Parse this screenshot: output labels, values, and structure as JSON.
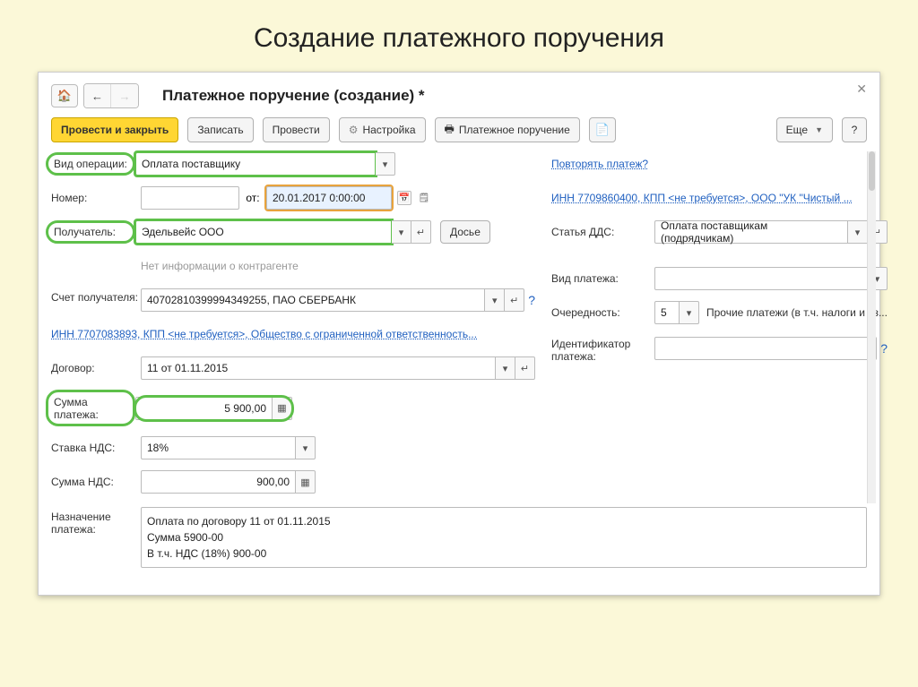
{
  "page_heading": "Создание платежного поручения",
  "window_title": "Платежное поручение (создание) *",
  "toolbar": {
    "post_close": "Провести и закрыть",
    "save": "Записать",
    "post": "Провести",
    "settings": "Настройка",
    "payment_order": "Платежное поручение",
    "more": "Еще",
    "help": "?"
  },
  "left": {
    "op_type_label": "Вид операции:",
    "op_type_value": "Оплата поставщику",
    "number_label": "Номер:",
    "from_label": "от:",
    "date_value": "20.01.2017  0:00:00",
    "recipient_label": "Получатель:",
    "recipient_value": "Эдельвейс ООО",
    "dossier_btn": "Досье",
    "no_info": "Нет информации о контрагенте",
    "recipient_account_label": "Счет получателя:",
    "recipient_account_value": "40702810399994349255, ПАО СБЕРБАНК",
    "org_link": "ИНН 7707083893, КПП <не требуется>, Общество с ограниченной ответственность...",
    "contract_label": "Договор:",
    "contract_value": "11 от 01.11.2015",
    "amount_label": "Сумма платежа:",
    "amount_value": "5 900,00",
    "vat_rate_label": "Ставка НДС:",
    "vat_rate_value": "18%",
    "vat_amount_label": "Сумма НДС:",
    "vat_amount_value": "900,00",
    "purpose_label": "Назначение платежа:",
    "purpose_l1": "Оплата по договору 11 от 01.11.2015",
    "purpose_l2": "Сумма 5900-00",
    "purpose_l3": "В т.ч. НДС  (18%) 900-00"
  },
  "right": {
    "repeat_link": "Повторять платеж?",
    "inn_link": "ИНН 7709860400, КПП <не требуется>, ООО \"УК \"Чистый ...",
    "dds_label": "Статья ДДС:",
    "dds_value": "Оплата поставщикам (подрядчикам)",
    "paytype_label": "Вид платежа:",
    "priority_label": "Очередность:",
    "priority_value": "5",
    "priority_text": "Прочие платежи (в т.ч. налоги и вз...",
    "id_label": "Идентификатор платежа:"
  }
}
